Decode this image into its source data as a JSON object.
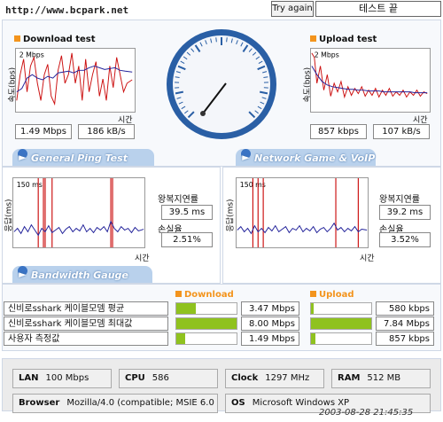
{
  "topbar": {
    "url": "http://www.bcpark.net",
    "try_again": "Try again",
    "end_test": "테스트 끝"
  },
  "download": {
    "title": "Download test",
    "scale": "2 Mbps",
    "yaxis": "속도(bps)",
    "xaxis": "시간",
    "mbps": "1.49 Mbps",
    "kbs": "186 kB/s"
  },
  "upload": {
    "title": "Upload test",
    "scale": "2 Mbps",
    "yaxis": "속도(bps)",
    "xaxis": "시간",
    "kbps": "857 kbps",
    "kbs": "107 kB/s"
  },
  "sections": {
    "ping": "General Ping Test",
    "game": "Network Game & VoIP Test",
    "bandwidth": "Bandwidth Gauge"
  },
  "ping_left": {
    "scale": "150 ms",
    "yaxis": "응답(ms)",
    "xaxis": "시간",
    "rtt_label": "왕복지연률",
    "rtt": "39.5 ms",
    "loss_label": "손실율",
    "loss": "2.51%"
  },
  "ping_right": {
    "scale": "150 ms",
    "yaxis": "응답(ms)",
    "xaxis": "시간",
    "rtt_label": "왕복지연률",
    "rtt": "39.2 ms",
    "loss_label": "손실율",
    "loss": "3.52%"
  },
  "gauge": {
    "download_label": "Download",
    "upload_label": "Upload",
    "rows": [
      {
        "label": "신비로sshark 케이블모뎀 평균",
        "down": "3.47 Mbps",
        "down_level": 0.33,
        "up": "580 kbps",
        "up_level": 0.05
      },
      {
        "label": "신비로sshark 케이블모뎀 최대값",
        "down": "8.00 Mbps",
        "down_level": 1.0,
        "up": "7.84 Mbps",
        "up_level": 1.0
      },
      {
        "label": "사용자 측정값",
        "down": "1.49 Mbps",
        "down_level": 0.14,
        "up": "857 kbps",
        "up_level": 0.07
      }
    ]
  },
  "sysinfo": {
    "lan_key": "LAN",
    "lan": "100 Mbps",
    "cpu_key": "CPU",
    "cpu": "586",
    "clock_key": "Clock",
    "clock": "1297 MHz",
    "ram_key": "RAM",
    "ram": "512 MB",
    "browser_key": "Browser",
    "browser": "Mozilla/4.0 (compatible; MSIE 6.0",
    "os_key": "OS",
    "os": "Microsoft Windows XP"
  },
  "timestamp": "2003-08-28 21:45:35",
  "colors": {
    "accent": "#f3941d",
    "bar": "#8fc21f",
    "section": "#b9d1ec",
    "dial": "#2a5fa5",
    "red": "#cc1111",
    "blue": "#22229a"
  }
}
